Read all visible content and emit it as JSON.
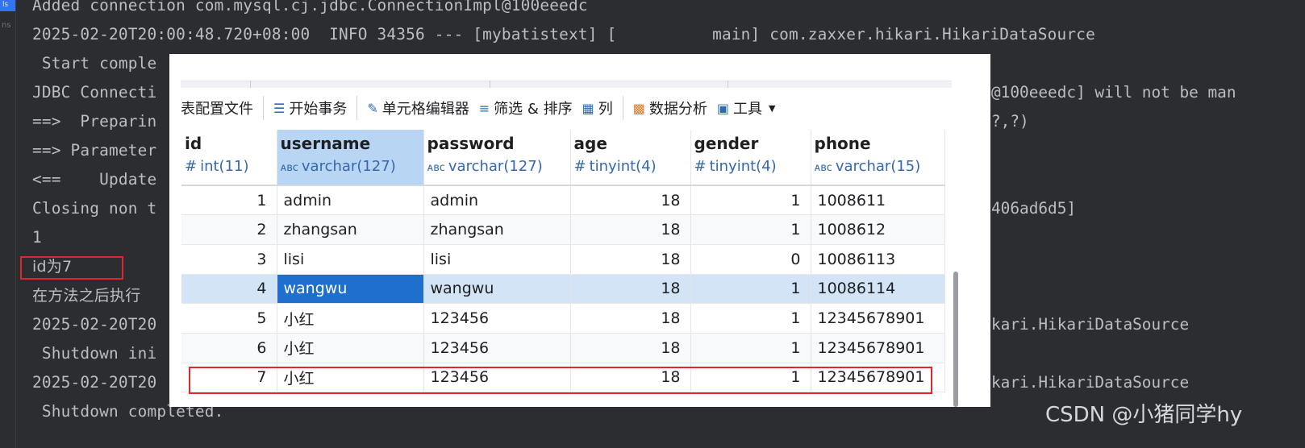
{
  "console": {
    "gutter_tab": "ls",
    "gutter_label": "ns",
    "lines": [
      "Added connection com.mysql.cj.jdbc.ConnectionImpl@100eeedc",
      "2025-02-20T20:00:48.720+08:00  INFO 34356 --- [mybatistext] [          main] com.zaxxer.hikari.HikariDataSource",
      " Start comple",
      "JDBC Connecti",
      "==>  Preparin",
      "==> Parameter",
      "<==    Update",
      "Closing non t",
      "1",
      "id为7",
      "在方法之后执行",
      "2025-02-20T20",
      " Shutdown ini",
      "2025-02-20T20",
      " Shutdown completed."
    ],
    "right_fragments": {
      "r3": "@100eeedc] will not be man",
      "r4": "?,?)",
      "r7": "406ad6d5]",
      "r11": "kari.HikariDataSource",
      "r13": "kari.HikariDataSource"
    }
  },
  "watermark": "CSDN @小猪同学hy",
  "db": {
    "toolbar": {
      "table_config": "表配置文件",
      "begin_tx": "开始事务",
      "cell_editor": "单元格编辑器",
      "filter_sort": "筛选 & 排序",
      "columns": "列",
      "data_analysis": "数据分析",
      "tools": "工具"
    },
    "columns": [
      {
        "name": "id",
        "type": "int(11)",
        "kind": "number"
      },
      {
        "name": "username",
        "type": "varchar(127)",
        "kind": "text"
      },
      {
        "name": "password",
        "type": "varchar(127)",
        "kind": "text"
      },
      {
        "name": "age",
        "type": "tinyint(4)",
        "kind": "number"
      },
      {
        "name": "gender",
        "type": "tinyint(4)",
        "kind": "number"
      },
      {
        "name": "phone",
        "type": "varchar(15)",
        "kind": "text"
      }
    ],
    "rows": [
      [
        "1",
        "admin",
        "admin",
        "18",
        "1",
        "1008611"
      ],
      [
        "2",
        "zhangsan",
        "zhangsan",
        "18",
        "1",
        "1008612"
      ],
      [
        "3",
        "lisi",
        "lisi",
        "18",
        "0",
        "10086113"
      ],
      [
        "4",
        "wangwu",
        "wangwu",
        "18",
        "1",
        "10086114"
      ],
      [
        "5",
        "小红",
        "123456",
        "18",
        "1",
        "12345678901"
      ],
      [
        "6",
        "小红",
        "123456",
        "18",
        "1",
        "12345678901"
      ],
      [
        "7",
        "小红",
        "123456",
        "18",
        "1",
        "12345678901"
      ]
    ],
    "selected_row": 3,
    "selected_column": 1,
    "highlighted_row": 6
  },
  "colors": {
    "console_bg": "#2b2d30",
    "console_text": "#bcbec4",
    "highlight_border": "#e3262d",
    "selection_blue": "#1f6fcf",
    "row_selection": "#d3e4f6"
  }
}
